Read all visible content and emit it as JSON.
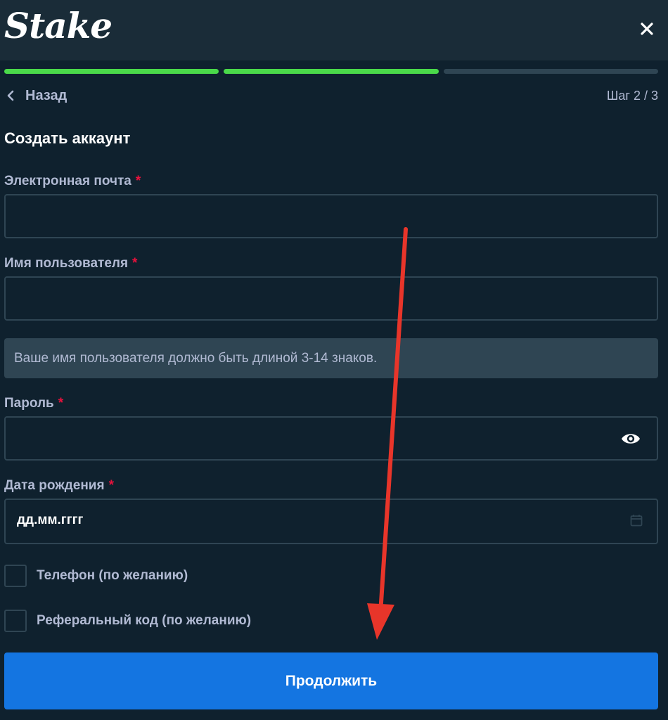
{
  "header": {
    "logo_text": "Stake",
    "close_icon": "close-icon"
  },
  "progress": {
    "total_steps": 3,
    "completed_steps": 2,
    "active_color": "#4ad94a",
    "inactive_color": "#2f4553"
  },
  "nav": {
    "back_label": "Назад",
    "back_icon": "chevron-left-icon",
    "step_label": "Шаг 2 / 3"
  },
  "form": {
    "title": "Создать аккаунт",
    "email": {
      "label": "Электронная почта",
      "required_mark": "*",
      "value": ""
    },
    "username": {
      "label": "Имя пользователя",
      "required_mark": "*",
      "value": "",
      "hint": "Ваше имя пользователя должно быть длиной 3-14 знаков."
    },
    "password": {
      "label": "Пароль",
      "required_mark": "*",
      "value": "",
      "toggle_icon": "eye-icon"
    },
    "birthdate": {
      "label": "Дата рождения",
      "required_mark": "*",
      "placeholder": "дд.мм.гггг",
      "icon": "calendar-icon"
    },
    "phone_option": {
      "label": "Телефон (по желанию)",
      "checked": false
    },
    "referral_option": {
      "label": "Реферальный код (по желанию)",
      "checked": false
    },
    "submit_label": "Продолжить"
  },
  "colors": {
    "background": "#0f212e",
    "header": "#1a2c38",
    "border": "#2f4553",
    "text_muted": "#b1bad3",
    "required": "#e9113c",
    "button": "#1475e1",
    "annotation_arrow": "#e8352a"
  }
}
